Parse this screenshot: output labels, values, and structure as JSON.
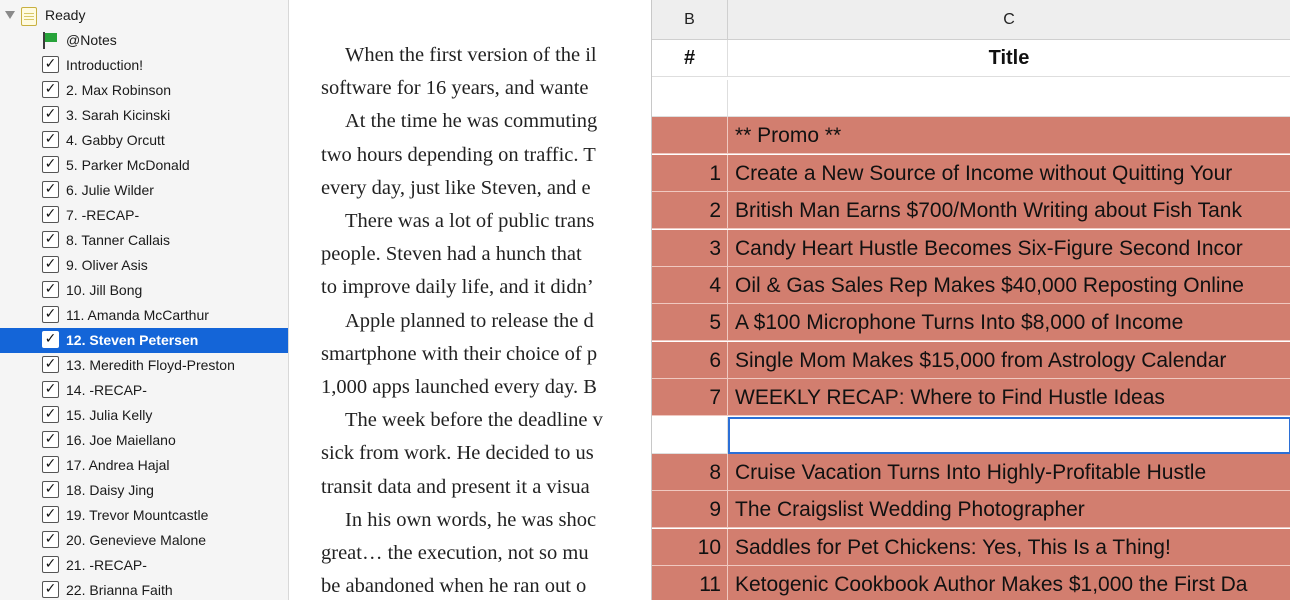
{
  "binder": {
    "root": {
      "label": "Ready",
      "icon": "folder-icon",
      "expanded": true
    },
    "notes": {
      "label": "@Notes",
      "icon": "flag-icon"
    },
    "items": [
      {
        "label": "Introduction!",
        "checked": true
      },
      {
        "label": "2. Max Robinson",
        "checked": true
      },
      {
        "label": "3. Sarah Kicinski",
        "checked": true
      },
      {
        "label": "4. Gabby Orcutt",
        "checked": true
      },
      {
        "label": "5. Parker McDonald",
        "checked": true
      },
      {
        "label": "6. Julie Wilder",
        "checked": true
      },
      {
        "label": "7. -RECAP-",
        "checked": true
      },
      {
        "label": "8. Tanner Callais",
        "checked": true
      },
      {
        "label": "9. Oliver Asis",
        "checked": true
      },
      {
        "label": "10. Jill Bong",
        "checked": true
      },
      {
        "label": "11. Amanda McCarthur",
        "checked": true
      },
      {
        "label": "12. Steven Petersen",
        "checked": true,
        "selected": true
      },
      {
        "label": "13. Meredith Floyd-Preston",
        "checked": true
      },
      {
        "label": "14. -RECAP-",
        "checked": true
      },
      {
        "label": "15. Julia Kelly",
        "checked": true
      },
      {
        "label": "16. Joe Maiellano",
        "checked": true
      },
      {
        "label": "17. Andrea Hajal",
        "checked": true
      },
      {
        "label": "18. Daisy Jing",
        "checked": true
      },
      {
        "label": "19. Trevor Mountcastle",
        "checked": true
      },
      {
        "label": "20. Genevieve Malone",
        "checked": true
      },
      {
        "label": "21. -RECAP-",
        "checked": true
      },
      {
        "label": "22. Brianna Faith",
        "checked": true
      }
    ],
    "selection_color": "#1465d8"
  },
  "document": {
    "lines": [
      {
        "text": "When the first version of the il",
        "indent": true
      },
      {
        "text": "software for 16 years, and wante",
        "indent": false
      },
      {
        "text": "At the time he was commuting",
        "indent": true
      },
      {
        "text": "two hours depending on traffic. T",
        "indent": false
      },
      {
        "text": "every day, just like Steven, and e",
        "indent": false
      },
      {
        "text": "There was a lot of public trans",
        "indent": true
      },
      {
        "text": "people. Steven had a hunch that",
        "indent": false
      },
      {
        "text": "to improve daily life, and it didn’",
        "indent": false
      },
      {
        "text": "Apple planned to release the d",
        "indent": true
      },
      {
        "text": "smartphone with their choice of p",
        "indent": false
      },
      {
        "text": "1,000 apps launched every day. B",
        "indent": false
      },
      {
        "text": "The week before the deadline v",
        "indent": true
      },
      {
        "text": "sick from work. He decided to us",
        "indent": false
      },
      {
        "text": "transit data and present it a visua",
        "indent": false
      },
      {
        "text": "In his own words, he was shoc",
        "indent": true
      },
      {
        "text": "great… the execution, not so mu",
        "indent": false
      },
      {
        "text": "be abandoned when he ran out o",
        "indent": false
      }
    ]
  },
  "sheet": {
    "columns": [
      "B",
      "C"
    ],
    "header": {
      "b": "#",
      "c": "Title"
    },
    "highlight_color": "#d27e6f",
    "rows": [
      {
        "b": "",
        "c": "",
        "style": "plain"
      },
      {
        "b": "",
        "c": "** Promo **",
        "style": "red"
      },
      {
        "b": "1",
        "c": "Create a New Source of Income without Quitting Your",
        "style": "red"
      },
      {
        "b": "2",
        "c": "British Man Earns $700/Month Writing about Fish Tank",
        "style": "red"
      },
      {
        "b": "3",
        "c": "Candy Heart Hustle Becomes Six-Figure Second Incor",
        "style": "red"
      },
      {
        "b": "4",
        "c": "Oil & Gas Sales Rep Makes $40,000 Reposting Online",
        "style": "red"
      },
      {
        "b": "5",
        "c": "A $100 Microphone Turns Into $8,000 of Income",
        "style": "red"
      },
      {
        "b": "6",
        "c": "Single Mom Makes $15,000 from Astrology Calendar",
        "style": "red"
      },
      {
        "b": "7",
        "c": "WEEKLY RECAP: Where to Find Hustle Ideas",
        "style": "red"
      },
      {
        "b": "",
        "c": "",
        "style": "selected"
      },
      {
        "b": "8",
        "c": "Cruise Vacation Turns Into Highly-Profitable Hustle",
        "style": "red"
      },
      {
        "b": "9",
        "c": "The Craigslist Wedding Photographer",
        "style": "red"
      },
      {
        "b": "10",
        "c": "Saddles for Pet Chickens: Yes, This Is a Thing!",
        "style": "red"
      },
      {
        "b": "11",
        "c": "Ketogenic Cookbook Author Makes $1,000 the First Da",
        "style": "red"
      }
    ]
  }
}
